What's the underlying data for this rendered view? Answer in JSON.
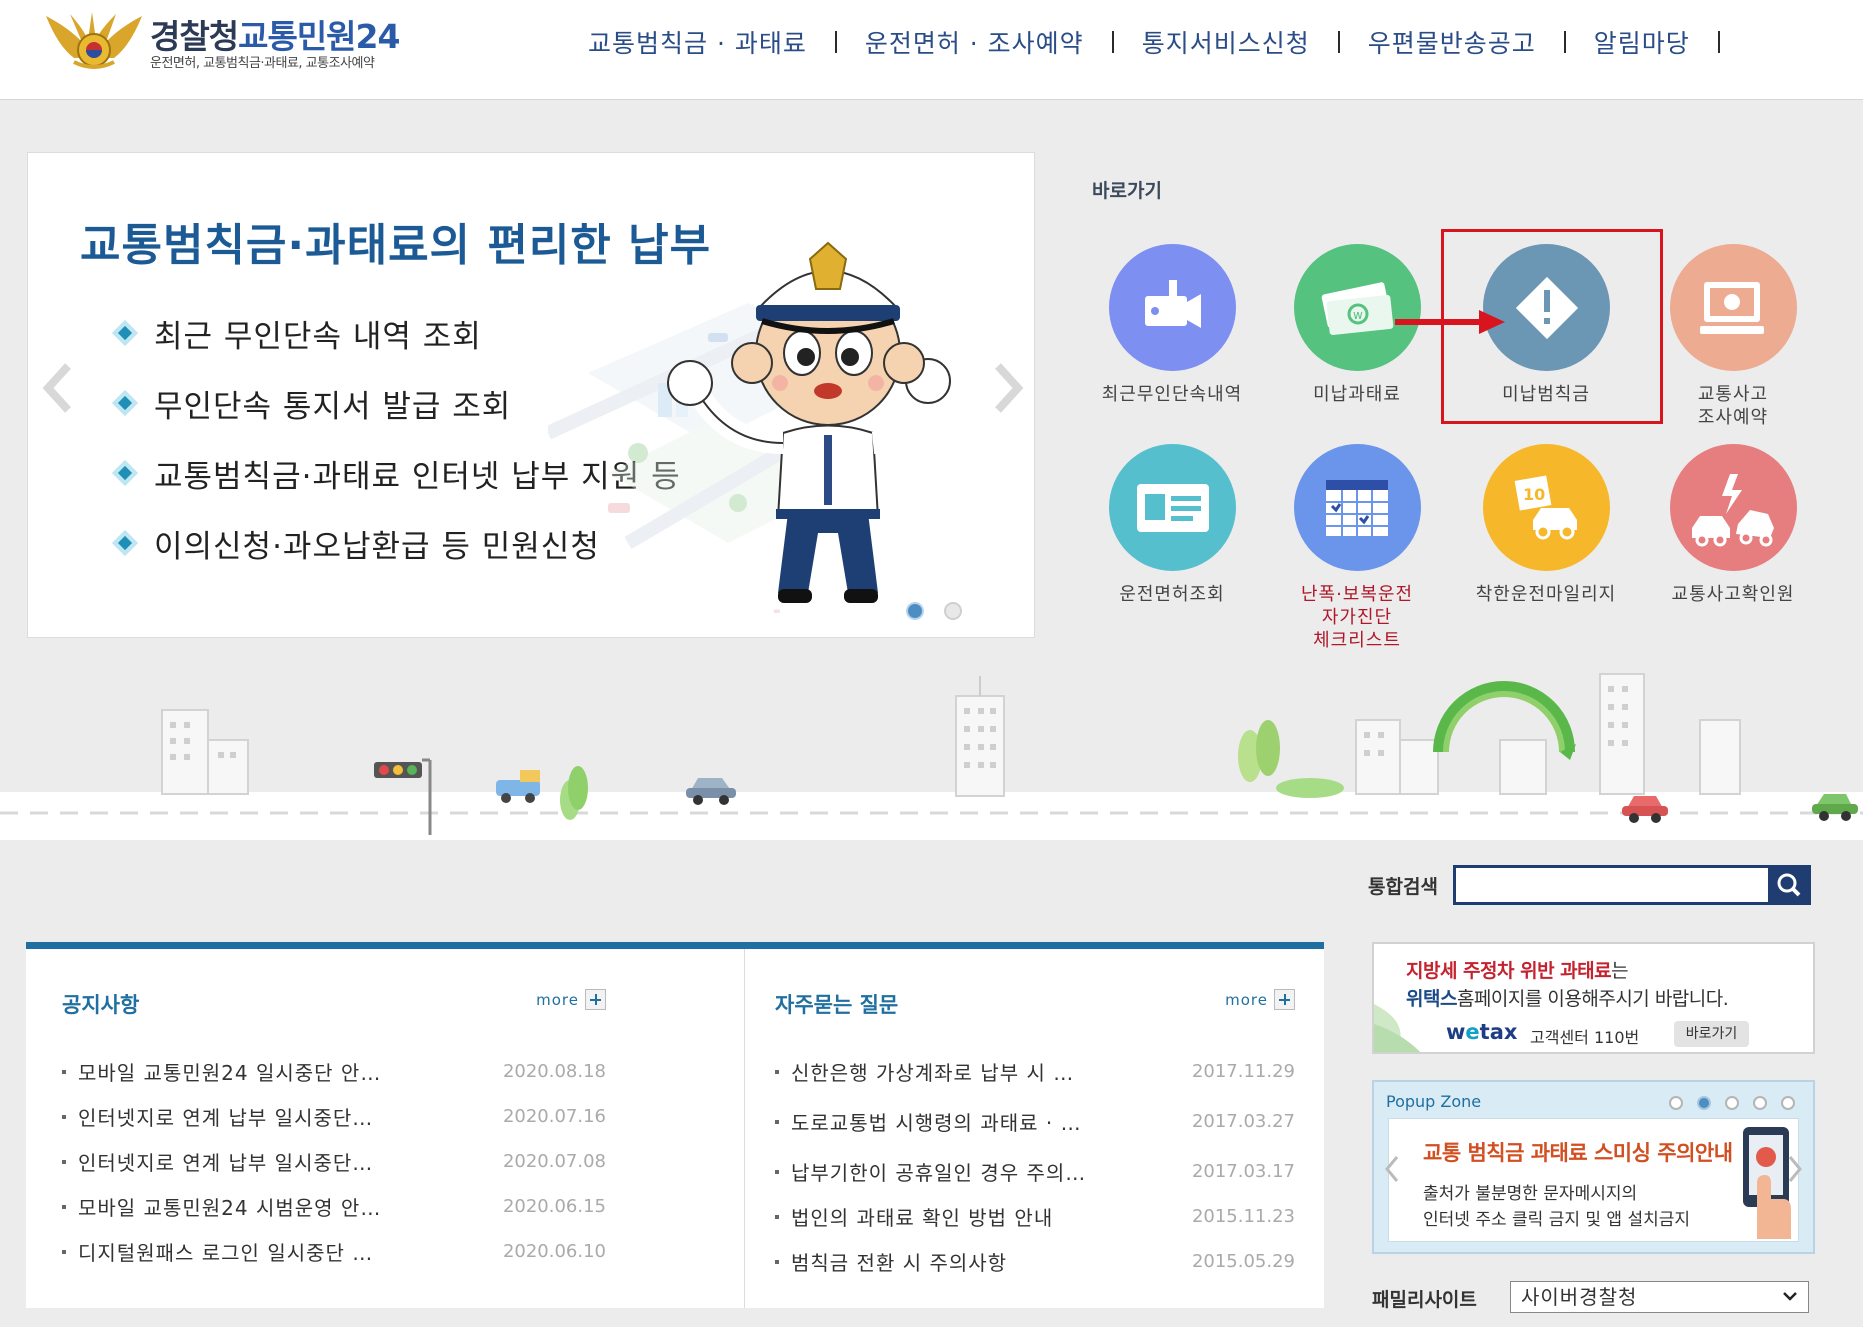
{
  "header": {
    "logo_org": "경찰청",
    "logo_service": "교통민원24",
    "logo_sub": "운전면허, 교통범칙금·과태료, 교통조사예약",
    "nav": [
      "교통범칙금 · 과태료",
      "운전면허 · 조사예약",
      "통지서비스신청",
      "우편물반송공고",
      "알림마당"
    ]
  },
  "banner": {
    "title": "교통범칙금·과태료의 편리한 납부",
    "items": [
      "최근 무인단속 내역 조회",
      "무인단속 통지서 발급 조회",
      "교통범칙금·과태료 인터넷 납부 지원 등",
      "이의신청·과오납환급 등 민원신청"
    ],
    "active_slide": 1,
    "slide_count": 2
  },
  "quick": {
    "title": "바로가기",
    "items": [
      {
        "label": "최근무인단속내역",
        "icon": "camera-icon",
        "color": "#7d8ff0"
      },
      {
        "label": "미납과태료",
        "icon": "money-icon",
        "color": "#55c27f"
      },
      {
        "label": "미납범칙금",
        "icon": "warning-icon",
        "color": "#6c97b4"
      },
      {
        "label": "교통사고\n조사예약",
        "icon": "monitor-icon",
        "color": "#edab91"
      },
      {
        "label": "운전면허조회",
        "icon": "id-card-icon",
        "color": "#55bfce"
      },
      {
        "label": "난폭·보복운전\n자가진단\n체크리스트",
        "icon": "calendar-check-icon",
        "color": "#6b95ea"
      },
      {
        "label": "착한운전마일리지",
        "icon": "mileage-car-icon",
        "color": "#f6b82a"
      },
      {
        "label": "교통사고확인원",
        "icon": "car-crash-icon",
        "color": "#e67d7f"
      }
    ]
  },
  "search": {
    "label": "통합검색",
    "placeholder": "",
    "value": ""
  },
  "notices": {
    "title": "공지사항",
    "more": "more",
    "items": [
      {
        "title": "모바일 교통민원24 일시중단 안…",
        "date": "2020.08.18"
      },
      {
        "title": "인터넷지로 연계 납부 일시중단…",
        "date": "2020.07.16"
      },
      {
        "title": "인터넷지로 연계 납부 일시중단…",
        "date": "2020.07.08"
      },
      {
        "title": "모바일 교통민원24 시범운영 안…",
        "date": "2020.06.15"
      },
      {
        "title": "디지털원패스 로그인 일시중단 …",
        "date": "2020.06.10"
      }
    ]
  },
  "faq": {
    "title": "자주묻는 질문",
    "more": "more",
    "items": [
      {
        "title": "신한은행 가상계좌로 납부 시 …",
        "date": "2017.11.29"
      },
      {
        "title": "도로교통법 시행령의 과태료 · …",
        "date": "2017.03.27"
      },
      {
        "title": "납부기한이 공휴일인 경우 주의…",
        "date": "2017.03.17"
      },
      {
        "title": "법인의 과태료 확인 방법 안내",
        "date": "2015.11.23"
      },
      {
        "title": "범칙금 전환 시 주의사항",
        "date": "2015.05.29"
      }
    ]
  },
  "wetax": {
    "line1_red": "지방세 주정차 위반 과태료",
    "line1_rest": "는",
    "line2_bold": "위택스",
    "line2_rest": "홈페이지를 이용해주시기 바랍니다.",
    "brand_w": "w",
    "brand_e": "e",
    "brand_tax": "tax",
    "center": "고객센터 110번",
    "go": "바로가기"
  },
  "popup": {
    "title": "Popup Zone",
    "active_dot": 2,
    "dot_count": 5,
    "headline": "교통 범칙금 과태료 스미싱 주의안내",
    "line1": "출처가 불분명한 문자메시지의",
    "line2": "인터넷 주소 클릭 금지 및 앱 설치금지"
  },
  "family": {
    "label": "패밀리사이트",
    "selected": "사이버경찰청"
  }
}
